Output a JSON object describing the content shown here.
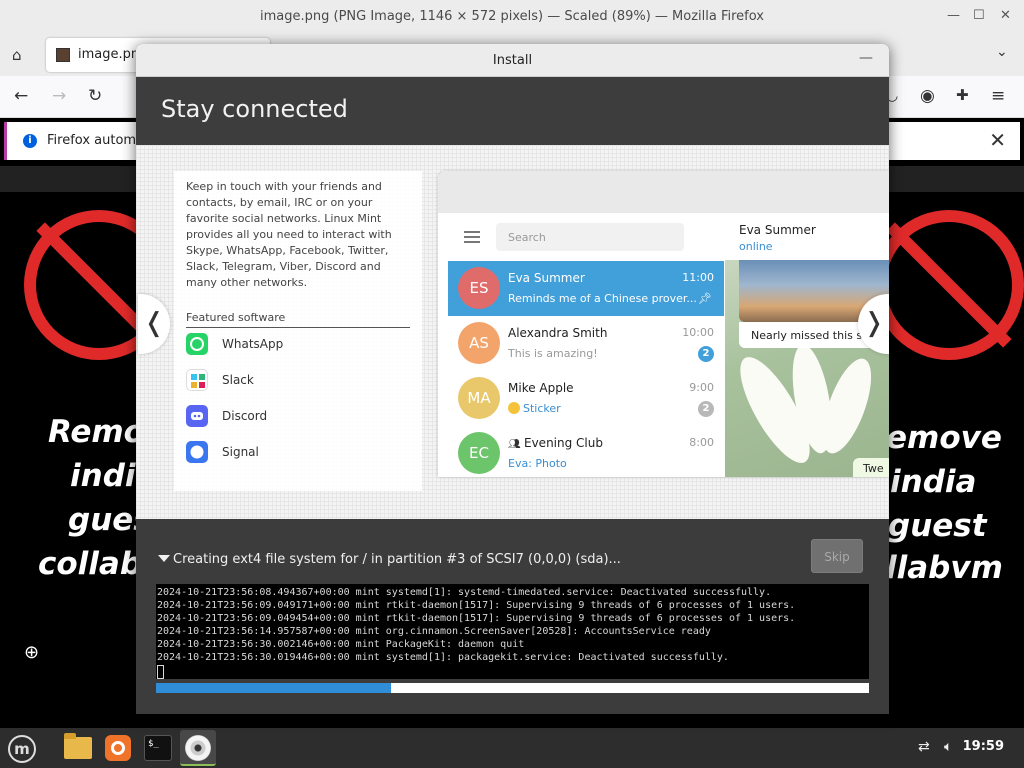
{
  "firefox": {
    "window_title": "image.png (PNG Image, 1146 × 572 pixels) — Scaled (89%) — Mozilla Firefox",
    "tab_label": "image.png",
    "notice_text": "Firefox automa",
    "bg_text_left": [
      "Remo",
      "indi",
      "gues",
      "collab"
    ],
    "bg_text_right": [
      "emove",
      "india",
      "guest",
      "llabvm"
    ]
  },
  "dialog": {
    "title": "Install",
    "heading": "Stay connected",
    "description": "Keep in touch with your friends and contacts, by email, IRC or on your favorite social networks. Linux Mint provides all you need to interact with Skype, WhatsApp, Facebook, Twitter, Slack, Telegram, Viber, Discord and many other networks.",
    "featured_title": "Featured software",
    "software": [
      {
        "name": "WhatsApp",
        "icon": "whatsapp-icon",
        "color": "#25d366"
      },
      {
        "name": "Slack",
        "icon": "slack-icon",
        "color": "#4a154b"
      },
      {
        "name": "Discord",
        "icon": "discord-icon",
        "color": "#5865f2"
      },
      {
        "name": "Signal",
        "icon": "signal-icon",
        "color": "#3a76f0"
      }
    ],
    "telegram": {
      "search_placeholder": "Search",
      "chats": [
        {
          "initials": "ES",
          "name": "Eva Summer",
          "time": "11:00",
          "preview": "Reminds me of a Chinese prover...",
          "color": "#e06b6b",
          "selected": true
        },
        {
          "initials": "AS",
          "name": "Alexandra Smith",
          "time": "10:00",
          "preview": "This is amazing!",
          "badge": "2",
          "color": "#f3a46b"
        },
        {
          "initials": "MA",
          "name": "Mike Apple",
          "time": "9:00",
          "preview": "Sticker",
          "badge": "2",
          "color": "#e8c86b"
        },
        {
          "initials": "EC",
          "name": "Evening Club",
          "time": "8:00",
          "preview": "Eva: Photo",
          "color": "#6dc56b"
        }
      ],
      "contact_name": "Eva Summer",
      "contact_status": "online",
      "photo_caption": "Nearly missed this s",
      "bubble_text": "Twe"
    },
    "progress_text": "Creating ext4 file system for / in partition #3 of SCSI7 (0,0,0) (sda)...",
    "skip_label": "Skip",
    "progress_percent": 33,
    "log_lines": [
      "2024-10-21T23:56:08.494367+00:00 mint systemd[1]: systemd-timedated.service: Deactivated successfully.",
      "2024-10-21T23:56:09.049171+00:00 mint rtkit-daemon[1517]: Supervising 9 threads of 6 processes of 1 users.",
      "2024-10-21T23:56:09.049454+00:00 mint rtkit-daemon[1517]: Supervising 9 threads of 6 processes of 1 users.",
      "2024-10-21T23:56:14.957587+00:00 mint org.cinnamon.ScreenSaver[20528]: AccountsService ready",
      "2024-10-21T23:56:30.002146+00:00 mint PackageKit: daemon quit",
      "2024-10-21T23:56:30.019446+00:00 mint systemd[1]: packagekit.service: Deactivated successfully."
    ]
  },
  "taskbar": {
    "clock": "19:59"
  }
}
